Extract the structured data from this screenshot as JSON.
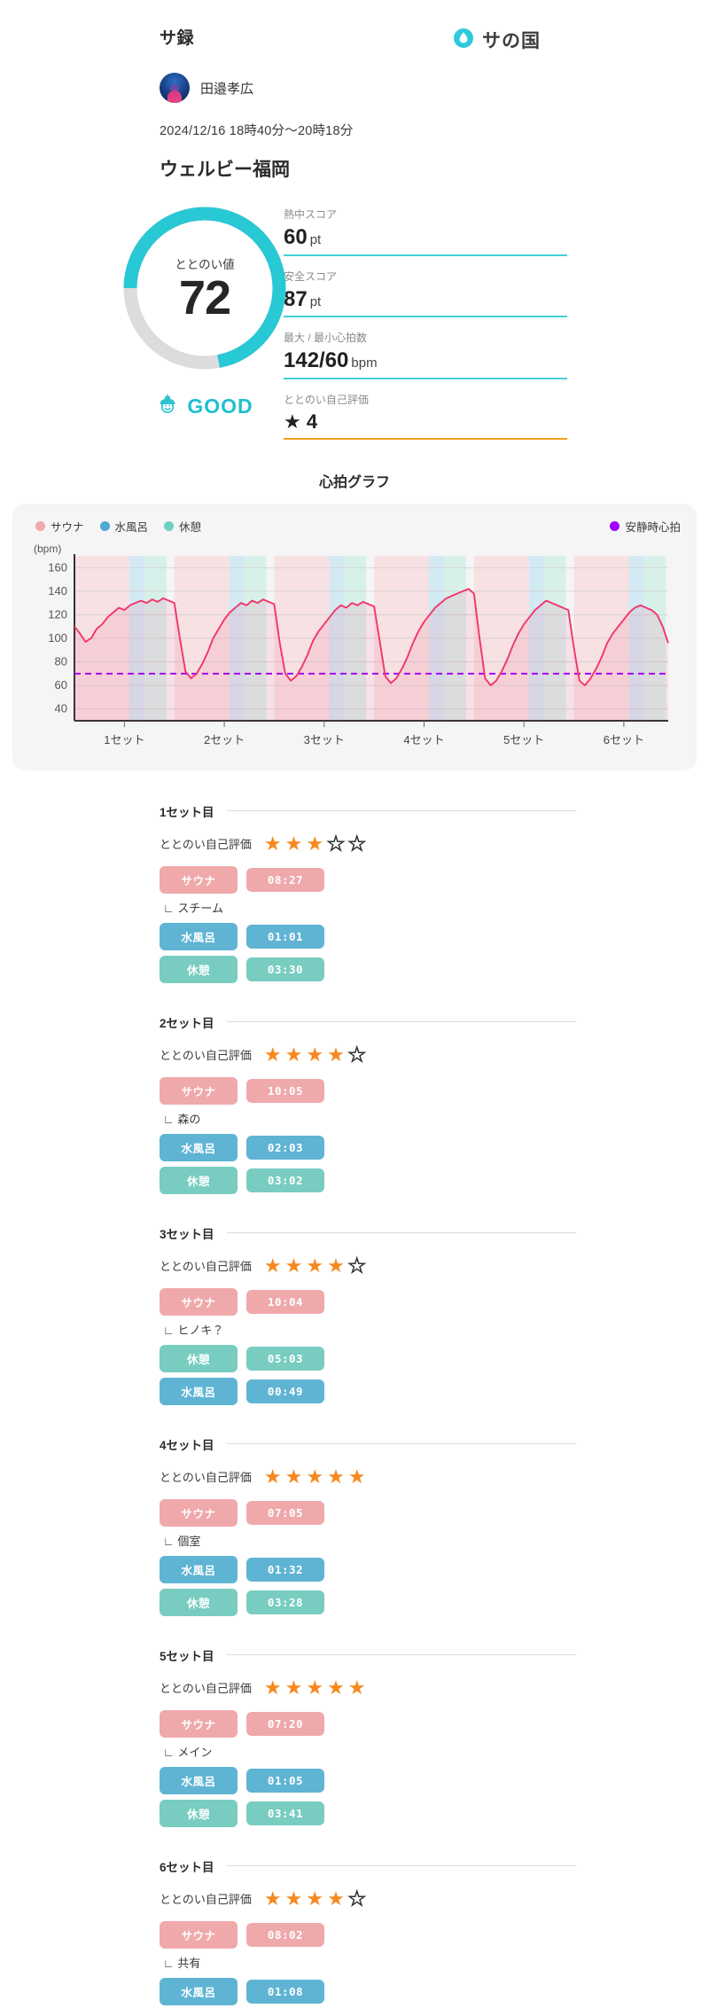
{
  "header": {
    "app_title": "サ録",
    "logo_text": "サの国",
    "logo_icon": "water-drop-icon"
  },
  "user": {
    "name": "田邉孝広",
    "avatar_alt": "user-avatar"
  },
  "session": {
    "date_range": "2024/12/16 18時40分〜20時18分",
    "venue": "ウェルビー福岡"
  },
  "score": {
    "gauge_label": "ととのい値",
    "gauge_value": "72",
    "gauge_percent": 72,
    "verdict_text": "GOOD",
    "verdict_icon": "sauna-mascot-icon",
    "accent_color": "#28c8d4",
    "track_color": "#dcdcdc"
  },
  "stats": [
    {
      "label": "熱中スコア",
      "value": "60",
      "unit": "pt",
      "accent": "#45d0d8"
    },
    {
      "label": "安全スコア",
      "value": "87",
      "unit": "pt",
      "accent": "#45d0d8"
    },
    {
      "label": "最大 / 最小心拍数",
      "value": "142/60",
      "unit": "bpm",
      "accent": "#45d0d8"
    },
    {
      "label": "ととのい自己評価",
      "value": "★ 4",
      "unit": "",
      "accent": "#f6a01a"
    }
  ],
  "chart": {
    "title": "心拍グラフ",
    "legend": [
      {
        "label": "サウナ",
        "color": "#efa9ab"
      },
      {
        "label": "水風呂",
        "color": "#4fa8cf"
      },
      {
        "label": "休憩",
        "color": "#6ecfc0"
      }
    ],
    "legend_right": {
      "label": "安静時心拍",
      "color": "#9d00ff"
    }
  },
  "chart_data": {
    "type": "line",
    "title": "心拍グラフ",
    "xlabel": "",
    "ylabel": "(bpm)",
    "yunit": "bpm",
    "ylim": [
      30,
      170
    ],
    "yticks": [
      40,
      60,
      80,
      100,
      120,
      140,
      160
    ],
    "grid": true,
    "legend_position": "top",
    "x_tick_labels": [
      "1セット",
      "2セット",
      "3セット",
      "4セット",
      "5セット",
      "6セット"
    ],
    "resting_hr": 70,
    "resting_hr_color": "#9d00ff",
    "series": [
      {
        "name": "心拍数",
        "color": "#f2356b",
        "values": [
          110,
          104,
          97,
          100,
          108,
          112,
          118,
          122,
          126,
          124,
          128,
          130,
          132,
          130,
          133,
          131,
          134,
          132,
          130,
          100,
          72,
          66,
          70,
          78,
          88,
          100,
          108,
          116,
          122,
          126,
          130,
          128,
          132,
          130,
          133,
          131,
          129,
          96,
          70,
          64,
          68,
          76,
          86,
          98,
          106,
          112,
          118,
          124,
          128,
          126,
          130,
          128,
          131,
          129,
          127,
          98,
          68,
          62,
          66,
          74,
          84,
          96,
          106,
          114,
          120,
          126,
          130,
          134,
          136,
          138,
          140,
          142,
          138,
          100,
          66,
          60,
          64,
          72,
          82,
          94,
          104,
          112,
          118,
          124,
          128,
          132,
          130,
          128,
          126,
          124,
          92,
          64,
          60,
          66,
          74,
          84,
          96,
          104,
          110,
          116,
          122,
          126,
          128,
          126,
          124,
          120,
          110,
          96
        ]
      }
    ],
    "phase_bands": [
      {
        "type": "サウナ",
        "color": "#f7dfe0"
      },
      {
        "type": "水風呂",
        "color": "#cfe8f3"
      },
      {
        "type": "休憩",
        "color": "#d5f0e9"
      }
    ]
  },
  "sets": [
    {
      "title": "1セット目",
      "rating_label": "ととのい自己評価",
      "rating": 3,
      "max_rating": 5,
      "note": "∟ スチーム",
      "phases": [
        {
          "label": "サウナ",
          "time": "08:27",
          "kind": "sauna"
        },
        {
          "label": "水風呂",
          "time": "01:01",
          "kind": "mizuburo"
        },
        {
          "label": "休憩",
          "time": "03:30",
          "kind": "kyukei"
        }
      ]
    },
    {
      "title": "2セット目",
      "rating_label": "ととのい自己評価",
      "rating": 4,
      "max_rating": 5,
      "note": "∟ 森の",
      "phases": [
        {
          "label": "サウナ",
          "time": "10:05",
          "kind": "sauna"
        },
        {
          "label": "水風呂",
          "time": "02:03",
          "kind": "mizuburo"
        },
        {
          "label": "休憩",
          "time": "03:02",
          "kind": "kyukei"
        }
      ]
    },
    {
      "title": "3セット目",
      "rating_label": "ととのい自己評価",
      "rating": 4,
      "max_rating": 5,
      "note": "∟ ヒノキ？",
      "phases": [
        {
          "label": "サウナ",
          "time": "10:04",
          "kind": "sauna"
        },
        {
          "label": "休憩",
          "time": "05:03",
          "kind": "kyukei"
        },
        {
          "label": "水風呂",
          "time": "00:49",
          "kind": "mizuburo"
        }
      ]
    },
    {
      "title": "4セット目",
      "rating_label": "ととのい自己評価",
      "rating": 5,
      "max_rating": 5,
      "note": "∟ 個室",
      "phases": [
        {
          "label": "サウナ",
          "time": "07:05",
          "kind": "sauna"
        },
        {
          "label": "水風呂",
          "time": "01:32",
          "kind": "mizuburo"
        },
        {
          "label": "休憩",
          "time": "03:28",
          "kind": "kyukei"
        }
      ]
    },
    {
      "title": "5セット目",
      "rating_label": "ととのい自己評価",
      "rating": 5,
      "max_rating": 5,
      "note": "∟ メイン",
      "phases": [
        {
          "label": "サウナ",
          "time": "07:20",
          "kind": "sauna"
        },
        {
          "label": "水風呂",
          "time": "01:05",
          "kind": "mizuburo"
        },
        {
          "label": "休憩",
          "time": "03:41",
          "kind": "kyukei"
        }
      ]
    },
    {
      "title": "6セット目",
      "rating_label": "ととのい自己評価",
      "rating": 4,
      "max_rating": 5,
      "note": "∟ 共有",
      "phases": [
        {
          "label": "サウナ",
          "time": "08:02",
          "kind": "sauna"
        },
        {
          "label": "水風呂",
          "time": "01:08",
          "kind": "mizuburo"
        }
      ]
    }
  ]
}
